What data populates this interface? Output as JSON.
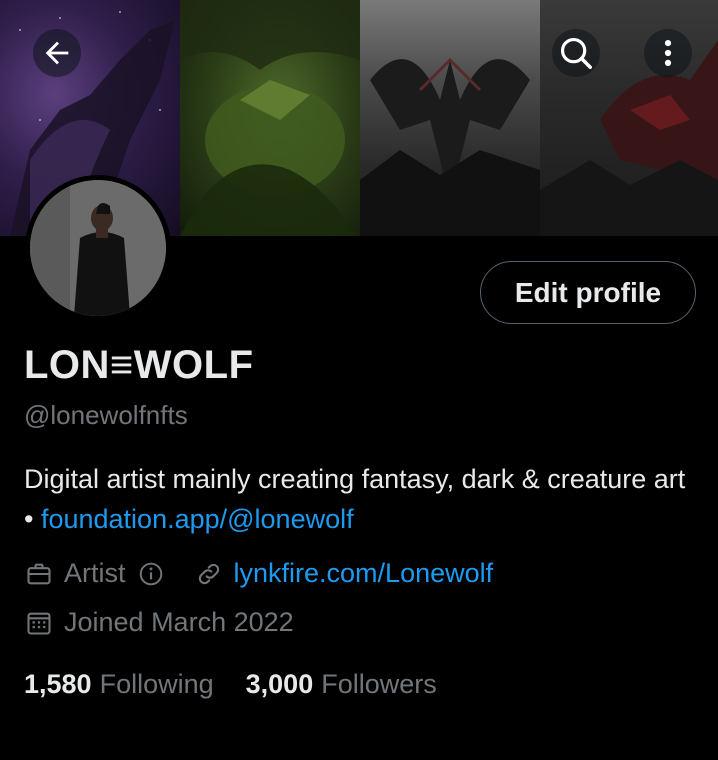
{
  "header": {
    "back_icon": "arrow-left-icon",
    "search_icon": "search-icon",
    "more_icon": "more-vertical-icon"
  },
  "profile": {
    "display_name": "LON≡WOLF",
    "handle": "@lonewolfnfts",
    "edit_button_label": "Edit profile",
    "bio_text": "Digital artist mainly creating fantasy, dark & creature art • ",
    "bio_link": "foundation.app/@lonewolf",
    "category": "Artist",
    "website": "lynkfire.com/Lonewolf",
    "joined": "Joined March 2022"
  },
  "stats": {
    "following_count": "1,580",
    "following_label": "Following",
    "followers_count": "3,000",
    "followers_label": "Followers"
  },
  "colors": {
    "background": "#000000",
    "text_primary": "#e7e9ea",
    "text_secondary": "#71767b",
    "link": "#1d9bf0",
    "button_border": "#536471"
  }
}
